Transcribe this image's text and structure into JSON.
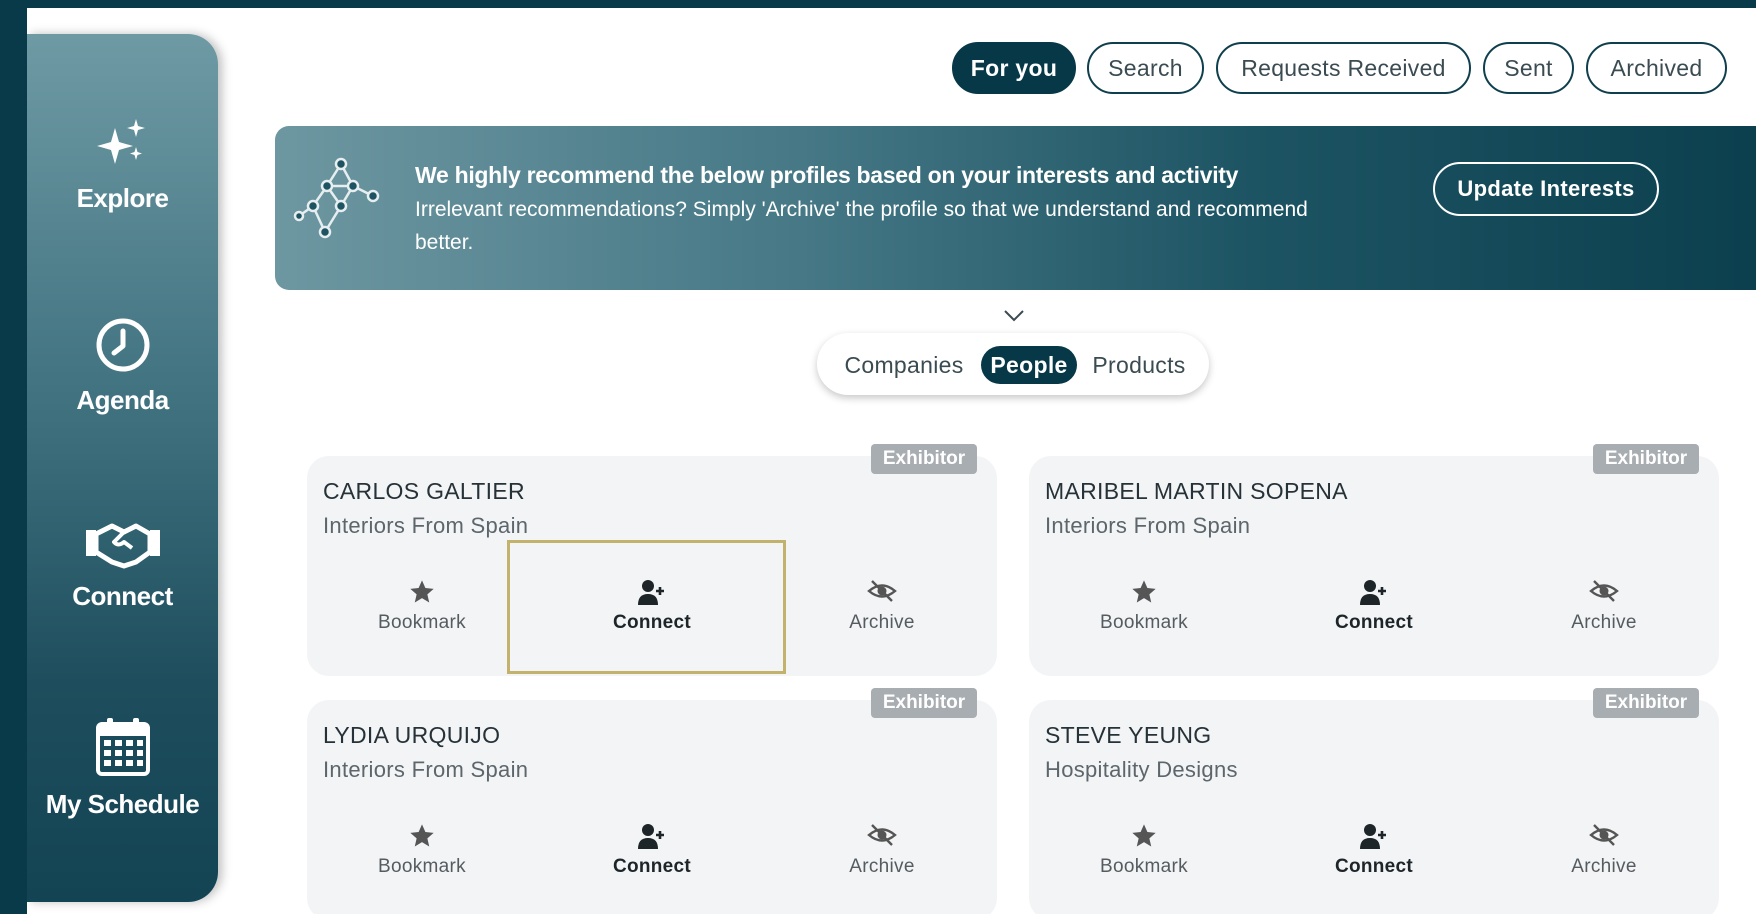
{
  "sidebar": {
    "items": [
      {
        "label": "Explore",
        "icon": "sparkles-icon"
      },
      {
        "label": "Agenda",
        "icon": "clock-icon"
      },
      {
        "label": "Connect",
        "icon": "handshake-icon"
      },
      {
        "label": "My Schedule",
        "icon": "calendar-icon"
      }
    ]
  },
  "tabs": [
    {
      "label": "For you",
      "active": true
    },
    {
      "label": "Search",
      "active": false
    },
    {
      "label": "Requests Received",
      "active": false
    },
    {
      "label": "Sent",
      "active": false
    },
    {
      "label": "Archived",
      "active": false
    }
  ],
  "banner": {
    "title": "We highly recommend the below profiles based on your interests and activity",
    "text": "Irrelevant recommendations? Simply 'Archive' the profile so that we understand and recommend better.",
    "button": "Update Interests"
  },
  "segments": [
    {
      "label": "Companies",
      "active": false
    },
    {
      "label": "People",
      "active": true
    },
    {
      "label": "Products",
      "active": false
    }
  ],
  "cards": [
    {
      "badge": "Exhibitor",
      "name": "CARLOS GALTIER",
      "company": "Interiors From Spain"
    },
    {
      "badge": "Exhibitor",
      "name": "MARIBEL MARTIN SOPENA",
      "company": "Interiors From Spain"
    },
    {
      "badge": "Exhibitor",
      "name": "LYDIA URQUIJO",
      "company": "Interiors From Spain"
    },
    {
      "badge": "Exhibitor",
      "name": "STEVE YEUNG",
      "company": "Hospitality Designs"
    }
  ],
  "actions": {
    "bookmark": "Bookmark",
    "connect": "Connect",
    "archive": "Archive"
  },
  "colors": {
    "primary": "#073848",
    "highlight": "#c2b26b",
    "badge": "#a8adb2"
  }
}
